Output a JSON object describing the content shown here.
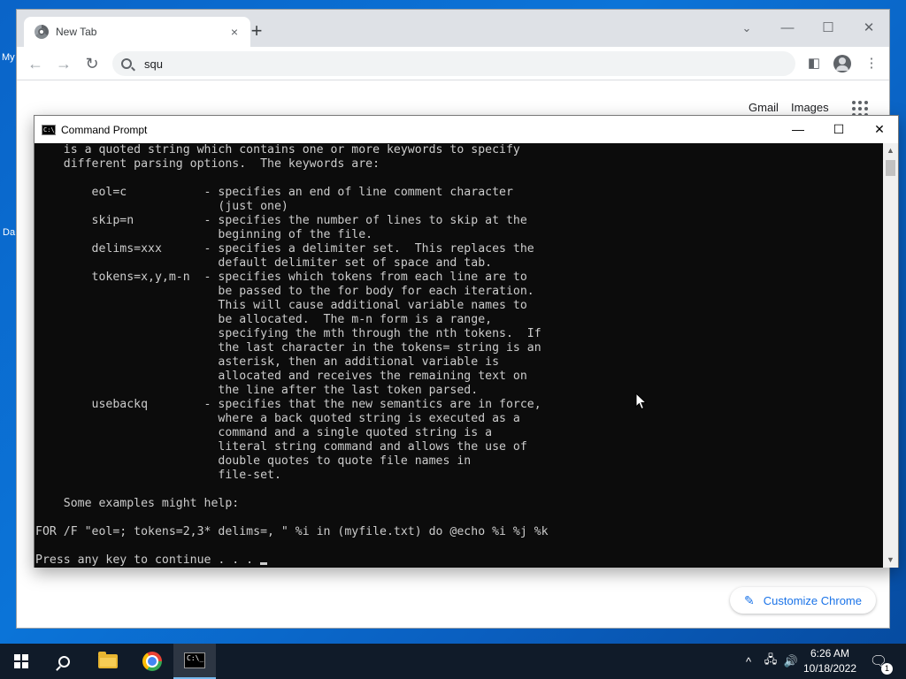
{
  "desktop": {
    "icon_fragments": [
      "My",
      "Da"
    ]
  },
  "chrome": {
    "tab": {
      "title": "New Tab",
      "close_glyph": "×"
    },
    "new_tab_glyph": "+",
    "window_controls": {
      "dropdown": "⌄",
      "minimize": "—",
      "maximize": "☐",
      "close": "✕"
    },
    "toolbar": {
      "back": "←",
      "forward": "→",
      "reload": "↻",
      "menu": "⋮",
      "sidepanel": "◧"
    },
    "omnibox": {
      "value": "squ"
    },
    "ntp": {
      "gmail_label": "Gmail",
      "images_label": "Images",
      "customize_label": "Customize Chrome",
      "customize_icon": "pencil-icon"
    }
  },
  "cmd": {
    "title": "Command Prompt",
    "icon_text": "C:\\_",
    "controls": {
      "minimize": "—",
      "maximize": "☐",
      "close": "✕"
    },
    "lines": [
      "    is a quoted string which contains one or more keywords to specify",
      "    different parsing options.  The keywords are:",
      "",
      "        eol=c           - specifies an end of line comment character",
      "                          (just one)",
      "        skip=n          - specifies the number of lines to skip at the",
      "                          beginning of the file.",
      "        delims=xxx      - specifies a delimiter set.  This replaces the",
      "                          default delimiter set of space and tab.",
      "        tokens=x,y,m-n  - specifies which tokens from each line are to",
      "                          be passed to the for body for each iteration.",
      "                          This will cause additional variable names to",
      "                          be allocated.  The m-n form is a range,",
      "                          specifying the mth through the nth tokens.  If",
      "                          the last character in the tokens= string is an",
      "                          asterisk, then an additional variable is",
      "                          allocated and receives the remaining text on",
      "                          the line after the last token parsed.",
      "        usebackq        - specifies that the new semantics are in force,",
      "                          where a back quoted string is executed as a",
      "                          command and a single quoted string is a",
      "                          literal string command and allows the use of",
      "                          double quotes to quote file names in",
      "                          file-set.",
      "",
      "    Some examples might help:",
      "",
      "FOR /F \"eol=; tokens=2,3* delims=, \" %i in (myfile.txt) do @echo %i %j %k",
      ""
    ],
    "prompt_line": "Press any key to continue . . . "
  },
  "taskbar": {
    "time": "6:26 AM",
    "date": "10/18/2022",
    "notification_count": "1",
    "tray": {
      "chevron": "^",
      "network": "🖧",
      "volume": "🔊"
    },
    "notification_glyph": "🗨"
  }
}
